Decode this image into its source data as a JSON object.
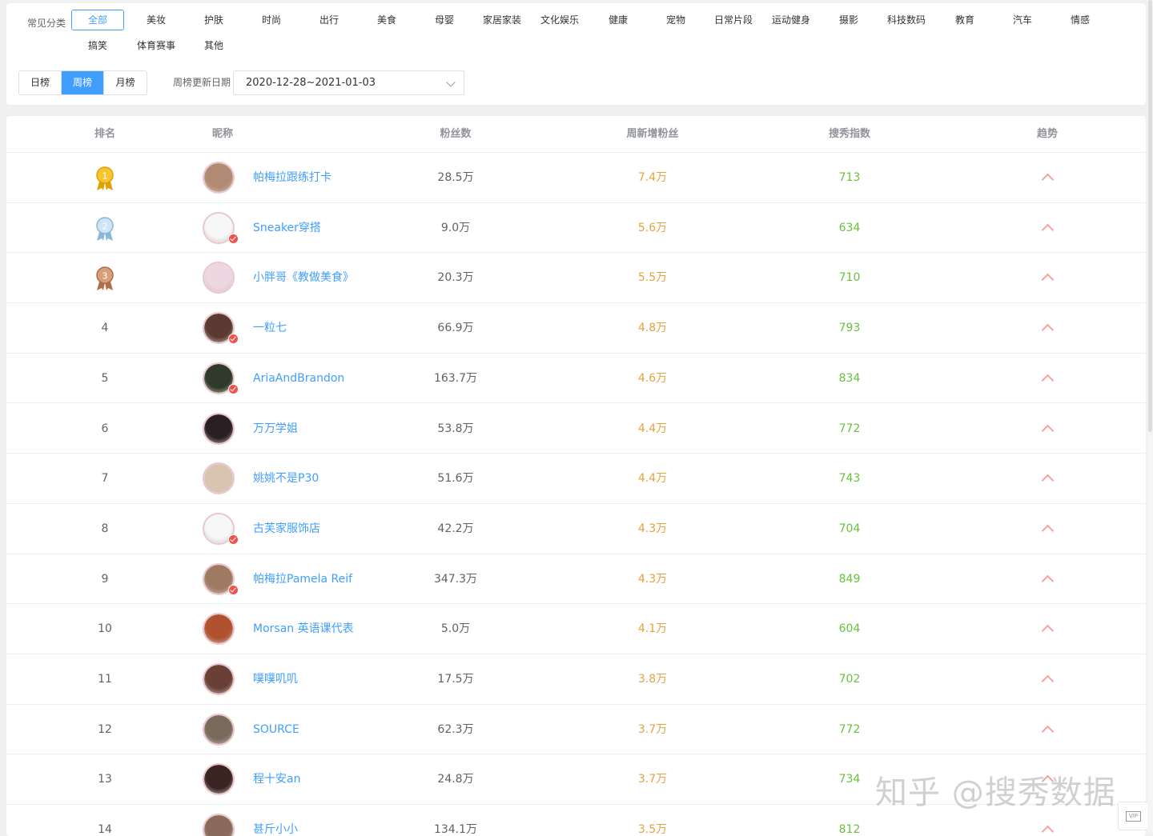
{
  "filters": {
    "category_label": "常见分类",
    "categories": [
      "全部",
      "美妆",
      "护肤",
      "时尚",
      "出行",
      "美食",
      "母婴",
      "家居家装",
      "文化娱乐",
      "健康",
      "宠物",
      "日常片段",
      "运动健身",
      "摄影",
      "科技数码",
      "教育",
      "汽车",
      "情感",
      "搞笑",
      "体育赛事",
      "其他"
    ],
    "active_category": "全部",
    "ranges": [
      "日榜",
      "周榜",
      "月榜"
    ],
    "active_range": "周榜",
    "date_label": "周榜更新日期",
    "date_value": "2020-12-28~2021-01-03"
  },
  "table": {
    "headers": {
      "rank": "排名",
      "nickname": "昵称",
      "fans": "粉丝数",
      "weekly_gain": "周新增粉丝",
      "index": "搜秀指数",
      "trend": "趋势"
    },
    "rows": [
      {
        "rank": "1",
        "name": "帕梅拉跟练打卡",
        "fans": "28.5万",
        "gain": "7.4万",
        "index": "713",
        "verified": false,
        "avatar_color": "#b08a72",
        "medal": "gold"
      },
      {
        "rank": "2",
        "name": "Sneaker穿搭",
        "fans": "9.0万",
        "gain": "5.6万",
        "index": "634",
        "verified": true,
        "avatar_color": "#f7f7f7",
        "medal": "silver"
      },
      {
        "rank": "3",
        "name": "小胖哥《教做美食》",
        "fans": "20.3万",
        "gain": "5.5万",
        "index": "710",
        "verified": false,
        "avatar_color": "#eed7e0",
        "medal": "bronze"
      },
      {
        "rank": "4",
        "name": "一粒七",
        "fans": "66.9万",
        "gain": "4.8万",
        "index": "793",
        "verified": true,
        "avatar_color": "#5a3a33"
      },
      {
        "rank": "5",
        "name": "AriaAndBrandon",
        "fans": "163.7万",
        "gain": "4.6万",
        "index": "834",
        "verified": true,
        "avatar_color": "#2f3a2a"
      },
      {
        "rank": "6",
        "name": "万万学姐",
        "fans": "53.8万",
        "gain": "4.4万",
        "index": "772",
        "verified": false,
        "avatar_color": "#2a1f22"
      },
      {
        "rank": "7",
        "name": "姚姚不是P30",
        "fans": "51.6万",
        "gain": "4.4万",
        "index": "743",
        "verified": false,
        "avatar_color": "#d9c4b0"
      },
      {
        "rank": "8",
        "name": "古芙家服饰店",
        "fans": "42.2万",
        "gain": "4.3万",
        "index": "704",
        "verified": true,
        "avatar_color": "#f7f7f7"
      },
      {
        "rank": "9",
        "name": "帕梅拉Pamela Reif",
        "fans": "347.3万",
        "gain": "4.3万",
        "index": "849",
        "verified": true,
        "avatar_color": "#9e7a63"
      },
      {
        "rank": "10",
        "name": "Morsan 英语课代表",
        "fans": "5.0万",
        "gain": "4.1万",
        "index": "604",
        "verified": false,
        "avatar_color": "#b0522e"
      },
      {
        "rank": "11",
        "name": "噗噗叽叽",
        "fans": "17.5万",
        "gain": "3.8万",
        "index": "702",
        "verified": false,
        "avatar_color": "#6a4036"
      },
      {
        "rank": "12",
        "name": "SOURCE",
        "fans": "62.3万",
        "gain": "3.7万",
        "index": "772",
        "verified": false,
        "avatar_color": "#7a6a5c"
      },
      {
        "rank": "13",
        "name": "程十安an",
        "fans": "24.8万",
        "gain": "3.7万",
        "index": "734",
        "verified": false,
        "avatar_color": "#3a2422"
      },
      {
        "rank": "14",
        "name": "甚斤小小",
        "fans": "134.1万",
        "gain": "3.5万",
        "index": "812",
        "verified": false,
        "avatar_color": "#8a6a5a"
      }
    ]
  },
  "watermark": "知乎 @搜秀数据",
  "vip_label": "VIP",
  "colors": {
    "accent": "#409eff",
    "gain": "#e6a23c",
    "index": "#67c23a",
    "trend": "#f4a39b"
  }
}
